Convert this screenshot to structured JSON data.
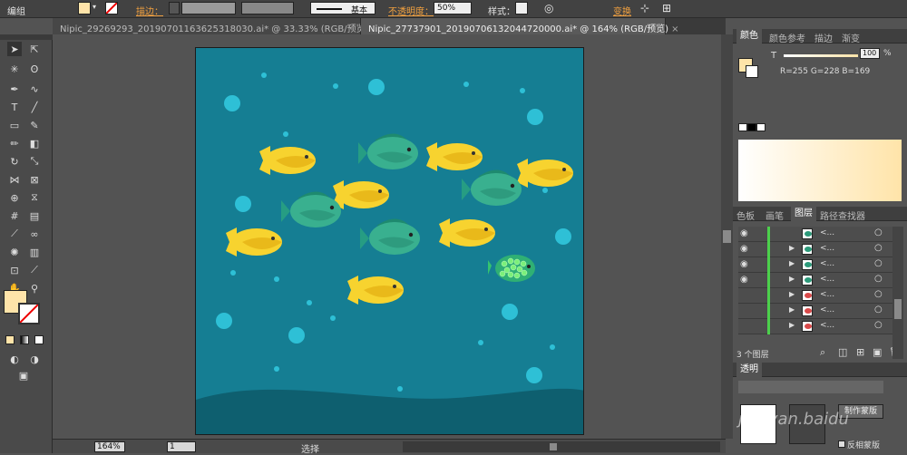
{
  "control_bar": {
    "group_label": "编组",
    "stroke_label": "描边：",
    "brush_label": "基本",
    "opacity_label": "不透明度：",
    "opacity_value": "50%",
    "style_label": "样式：",
    "transform_label": "变换",
    "fill_color": "#ffe4a9"
  },
  "tabs": [
    {
      "label": "Nipic_29269293_20190701163625318030.ai* @ 33.33% (RGB/预览)"
    },
    {
      "label": "Nipic_27737901_20190706132044720000.ai* @ 164% (RGB/预览)"
    }
  ],
  "color_panel": {
    "tabs": [
      "颜色",
      "颜色参考",
      "描边",
      "渐变"
    ],
    "t_label": "T",
    "t_value": "100",
    "pct": "%",
    "rgb_readout": "R=255  G=228  B=169",
    "fill_color": "#ffe4a9"
  },
  "layers_panel": {
    "tabs": [
      "色板",
      "画笔",
      "图层",
      "路径查找器"
    ],
    "row_label": "<...",
    "layer_count": "3 个图层"
  },
  "transparency_panel": {
    "title": "透明",
    "make_mask_button": "制作蒙版",
    "invert_mask_label": "反相蒙版"
  },
  "status_bar": {
    "zoom": "164%",
    "page": "1",
    "tool_name": "选择"
  },
  "watermark": {
    "text": "jingyan.baidu"
  }
}
